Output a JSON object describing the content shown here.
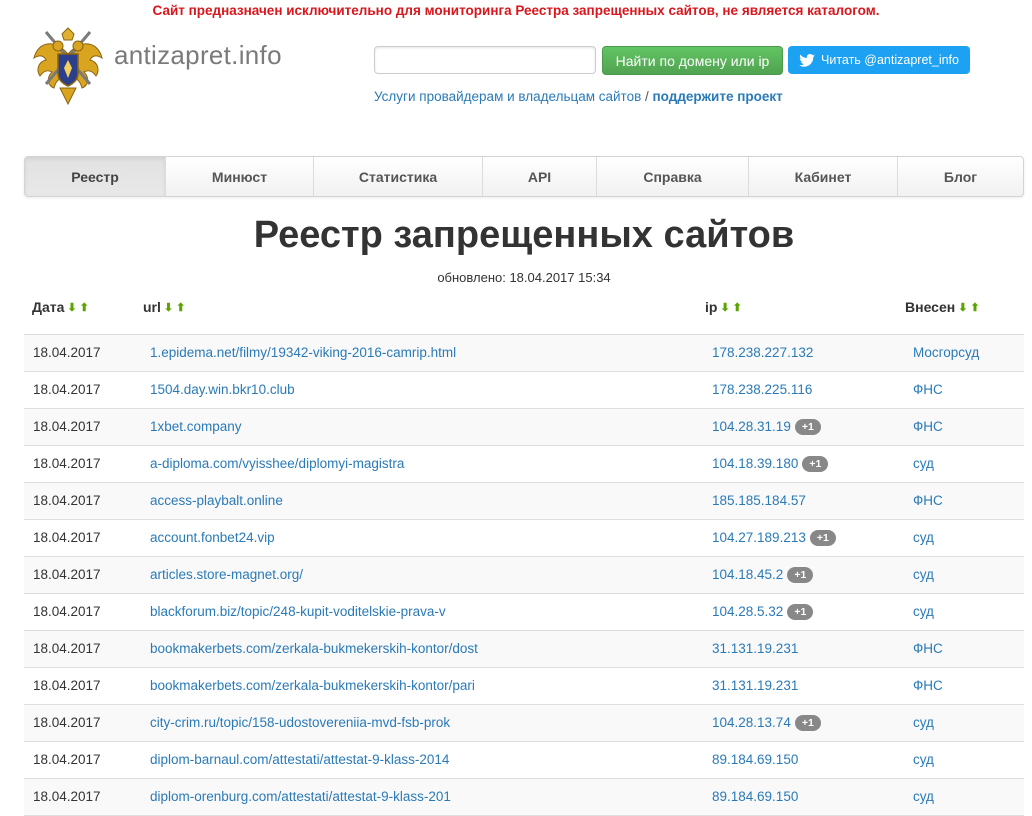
{
  "notice": "Сайт предназначен исключительно для мониторинга Реестра запрещенных сайтов, не является каталогом.",
  "header": {
    "site_name": "antizapret.info",
    "search": {
      "value": "",
      "placeholder": ""
    },
    "find_button": "Найти по домену или ip",
    "twitter_button": "Читать @antizapret_info",
    "promo_link": "Услуги провайдерам и владельцам сайтов",
    "promo_sep": " / ",
    "support_link": "поддержите проект"
  },
  "nav": {
    "items": [
      "Реестр",
      "Минюст",
      "Статистика",
      "API",
      "Справка",
      "Кабинет",
      "Блог"
    ],
    "active": "Реестр"
  },
  "page": {
    "title": "Реестр запрещенных сайтов",
    "updated": "обновлено: 18.04.2017 15:34"
  },
  "table": {
    "headers": {
      "date": "Дата",
      "url": "url",
      "ip": "ip",
      "source": "Внесен"
    },
    "rows": [
      {
        "date": "18.04.2017",
        "url": "1.epidema.net/filmy/19342-viking-2016-camrip.html",
        "ip": "178.238.227.132",
        "badge": "",
        "source": "Мосгорсуд"
      },
      {
        "date": "18.04.2017",
        "url": "1504.day.win.bkr10.club",
        "ip": "178.238.225.116",
        "badge": "",
        "source": "ФНС"
      },
      {
        "date": "18.04.2017",
        "url": "1xbet.company",
        "ip": "104.28.31.19",
        "badge": "+1",
        "source": "ФНС"
      },
      {
        "date": "18.04.2017",
        "url": "a-diploma.com/vyisshee/diplomyi-magistra",
        "ip": "104.18.39.180",
        "badge": "+1",
        "source": "суд"
      },
      {
        "date": "18.04.2017",
        "url": "access-playbalt.online",
        "ip": "185.185.184.57",
        "badge": "",
        "source": "ФНС"
      },
      {
        "date": "18.04.2017",
        "url": "account.fonbet24.vip",
        "ip": "104.27.189.213",
        "badge": "+1",
        "source": "суд"
      },
      {
        "date": "18.04.2017",
        "url": "articles.store-magnet.org/",
        "ip": "104.18.45.2",
        "badge": "+1",
        "source": "суд"
      },
      {
        "date": "18.04.2017",
        "url": "blackforum.biz/topic/248-kupit-voditelskie-prava-v",
        "ip": "104.28.5.32",
        "badge": "+1",
        "source": "суд"
      },
      {
        "date": "18.04.2017",
        "url": "bookmakerbets.com/zerkala-bukmekerskih-kontor/dost",
        "ip": "31.131.19.231",
        "badge": "",
        "source": "ФНС"
      },
      {
        "date": "18.04.2017",
        "url": "bookmakerbets.com/zerkala-bukmekerskih-kontor/pari",
        "ip": "31.131.19.231",
        "badge": "",
        "source": "ФНС"
      },
      {
        "date": "18.04.2017",
        "url": "city-crim.ru/topic/158-udostovereniia-mvd-fsb-prok",
        "ip": "104.28.13.74",
        "badge": "+1",
        "source": "суд"
      },
      {
        "date": "18.04.2017",
        "url": "diplom-barnaul.com/attestati/attestat-9-klass-2014",
        "ip": "89.184.69.150",
        "badge": "",
        "source": "суд"
      },
      {
        "date": "18.04.2017",
        "url": "diplom-orenburg.com/attestati/attestat-9-klass-201",
        "ip": "89.184.69.150",
        "badge": "",
        "source": "суд"
      }
    ]
  },
  "colors": {
    "notice": "#d9161c",
    "link": "#2a7ab8",
    "find_button": "#5bb75b",
    "twitter": "#1da1f2",
    "sort_arrow": "#5aa400"
  }
}
